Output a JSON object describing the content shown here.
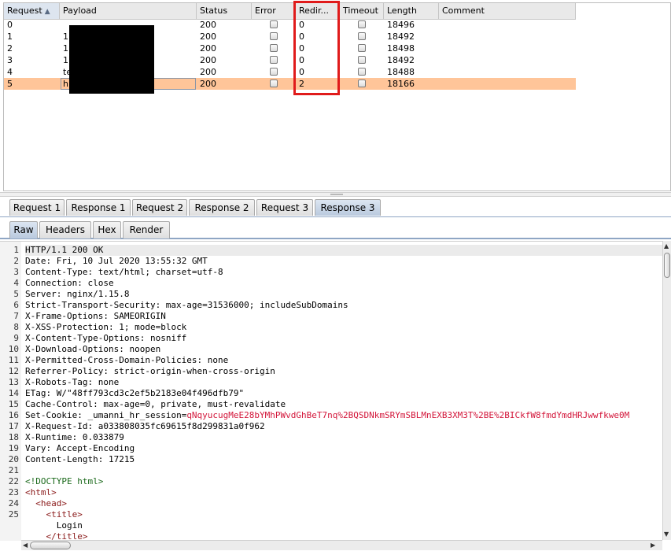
{
  "results": {
    "columns": [
      "Request",
      "Payload",
      "Status",
      "Error",
      "Redir...",
      "Timeout",
      "Length",
      "Comment"
    ],
    "sort_indicator": "▲",
    "rows": [
      {
        "request": "0",
        "payload": "",
        "status": "200",
        "redir": "0",
        "length": "18496"
      },
      {
        "request": "1",
        "payload": "1",
        "status": "200",
        "redir": "0",
        "length": "18492"
      },
      {
        "request": "2",
        "payload": "1",
        "status": "200",
        "redir": "0",
        "length": "18498"
      },
      {
        "request": "3",
        "payload": "1",
        "status": "200",
        "redir": "0",
        "length": "18492"
      },
      {
        "request": "4",
        "payload": "te",
        "status": "200",
        "redir": "0",
        "length": "18488"
      },
      {
        "request": "5",
        "payload": "h",
        "status": "200",
        "redir": "2",
        "length": "18166"
      }
    ],
    "selected_row": 5,
    "highlight_color": "#e01b1b",
    "selected_color": "#ffc599"
  },
  "tabs": {
    "items": [
      "Request 1",
      "Response 1",
      "Request 2",
      "Response 2",
      "Request 3",
      "Response 3"
    ],
    "active": "Response 3"
  },
  "view_tabs": {
    "items": [
      "Raw",
      "Headers",
      "Hex",
      "Render"
    ],
    "active": "Raw"
  },
  "editor": {
    "lines": [
      {
        "n": "1",
        "k": "HTTP/1.1 200 OK",
        "v": ""
      },
      {
        "n": "2",
        "k": "Date:",
        "v": " Fri, 10 Jul 2020 13:55:32 GMT"
      },
      {
        "n": "3",
        "k": "Content-Type:",
        "v": " text/html; charset=utf-8"
      },
      {
        "n": "4",
        "k": "Connection:",
        "v": " close"
      },
      {
        "n": "5",
        "k": "Server:",
        "v": " nginx/1.15.8"
      },
      {
        "n": "6",
        "k": "Strict-Transport-Security:",
        "v": " max-age=31536000; includeSubDomains"
      },
      {
        "n": "7",
        "k": "X-Frame-Options:",
        "v": " SAMEORIGIN"
      },
      {
        "n": "8",
        "k": "X-XSS-Protection:",
        "v": " 1; mode=block"
      },
      {
        "n": "9",
        "k": "X-Content-Type-Options:",
        "v": " nosniff"
      },
      {
        "n": "10",
        "k": "X-Download-Options:",
        "v": " noopen"
      },
      {
        "n": "11",
        "k": "X-Permitted-Cross-Domain-Policies:",
        "v": " none"
      },
      {
        "n": "12",
        "k": "Referrer-Policy:",
        "v": " strict-origin-when-cross-origin"
      },
      {
        "n": "13",
        "k": "X-Robots-Tag:",
        "v": " none"
      },
      {
        "n": "14",
        "k": "ETag:",
        "v": " W/\"48ff793cd3c2ef5b2183e04f496dfb79\""
      },
      {
        "n": "15",
        "k": "Cache-Control:",
        "v": " max-age=0, private, must-revalidate"
      },
      {
        "n": "16",
        "k": "Set-Cookie:",
        "v": " _umanni_hr_session=",
        "red": "qNqyucugMeE28bYMhPWvdGhBeT7nq%2BQSDNkmSRYmSBLMnEXB3XM3T%2BE%2BICkfW8fmdYmdHRJwwfkwe0M"
      },
      {
        "n": "17",
        "k": "X-Request-Id:",
        "v": " a033808035fc69615f8d299831a0f962"
      },
      {
        "n": "18",
        "k": "X-Runtime:",
        "v": " 0.033879"
      },
      {
        "n": "19",
        "k": "Vary:",
        "v": " Accept-Encoding"
      },
      {
        "n": "20",
        "k": "Content-Length:",
        "v": " 17215"
      },
      {
        "n": "21",
        "k": "",
        "v": ""
      },
      {
        "n": "22",
        "doc": "<!DOCTYPE html>"
      },
      {
        "n": "23",
        "tag": "<html>"
      },
      {
        "n": "24",
        "tag": "  <head>"
      },
      {
        "n": "25",
        "tag": "    <title>"
      },
      {
        "n": "",
        "v": "      Login"
      },
      {
        "n": "",
        "tag": "    </title>"
      }
    ]
  }
}
